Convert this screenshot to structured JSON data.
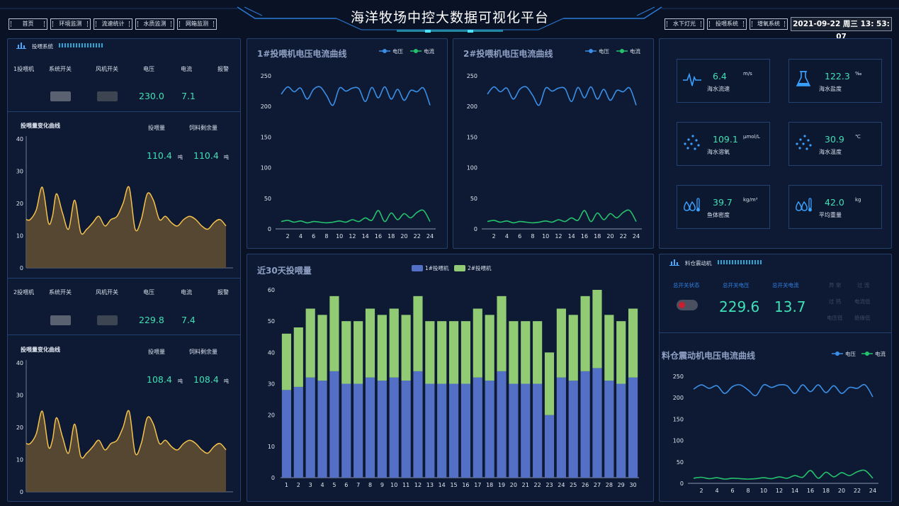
{
  "header": {
    "title": "海洋牧场中控大数据可视化平台",
    "nav_left": [
      "首页",
      "环境监测",
      "流速统计",
      "水质监测",
      "网箱监测"
    ],
    "nav_right": [
      "水下灯光",
      "投喂系统",
      "增氧系统"
    ],
    "datetime": "2021-09-22 周三 13: 53: 07"
  },
  "feeder_panel": {
    "title": "投喂系统",
    "columns": [
      "系统开关",
      "风机开关",
      "电压",
      "电流",
      "报警"
    ],
    "units": [
      {
        "name": "1投喂机",
        "voltage": "230.0",
        "current": "7.1",
        "curve_title": "投喂量变化曲线",
        "feed_label": "投喂量",
        "remain_label": "饲料剩余量",
        "feed": "110.4",
        "feed_unit": "吨",
        "remain": "110.4",
        "remain_unit": "吨"
      },
      {
        "name": "2投喂机",
        "voltage": "229.8",
        "current": "7.4",
        "curve_title": "投喂量变化曲线",
        "feed_label": "投喂量",
        "remain_label": "饲料剩余量",
        "feed": "108.4",
        "feed_unit": "吨",
        "remain": "108.4",
        "remain_unit": "吨"
      }
    ]
  },
  "vc_legend": {
    "voltage": "电压",
    "current": "电流"
  },
  "sensors": [
    {
      "value": "6.4",
      "unit": "m/s",
      "label": "海水流速",
      "icon": "pulse-icon"
    },
    {
      "value": "122.3",
      "unit": "‰",
      "label": "海水盐度",
      "icon": "flask-icon"
    },
    {
      "value": "109.1",
      "unit": "μmol/L",
      "label": "海水溶氧",
      "icon": "bubbles-icon"
    },
    {
      "value": "30.9",
      "unit": "℃",
      "label": "海水温度",
      "icon": "bubbles-icon"
    },
    {
      "value": "39.7",
      "unit": "kg/m³",
      "label": "鱼体密度",
      "icon": "drops-thermometer-icon"
    },
    {
      "value": "42.0",
      "unit": "kg",
      "label": "平均重量",
      "icon": "drops-thermometer-icon"
    }
  ],
  "hopper_panel": {
    "title": "料仓震动机",
    "headers": [
      "总开关状态",
      "总开关电压",
      "总开关电流"
    ],
    "voltage": "229.6",
    "current": "13.7",
    "alarms": [
      "异 常",
      "过 流",
      "过 热",
      "电流低",
      "电压低",
      "绝缘低"
    ],
    "curve_title": "料仓震动机电压电流曲线"
  },
  "colors": {
    "voltage": "#3a8ee6",
    "current": "#25c26e",
    "feed_line": "#f4c24c",
    "bar1": "#5470c6",
    "bar2": "#91cc75",
    "accent": "#3fe0b6"
  },
  "chart_data": [
    {
      "type": "line",
      "title": "1#投喂机电压电流曲线",
      "x": [
        1,
        2,
        3,
        4,
        5,
        6,
        7,
        8,
        9,
        10,
        11,
        12,
        13,
        14,
        15,
        16,
        17,
        18,
        19,
        20,
        21,
        22,
        23,
        24
      ],
      "ylim": [
        0,
        250
      ],
      "yticks": [
        0,
        50,
        100,
        150,
        200,
        250
      ],
      "xticks": [
        2,
        4,
        6,
        8,
        10,
        12,
        14,
        16,
        18,
        20,
        22,
        24
      ],
      "series": [
        {
          "name": "电压",
          "values": [
            220,
            232,
            224,
            230,
            212,
            228,
            232,
            218,
            202,
            230,
            225,
            230,
            229,
            208,
            231,
            214,
            232,
            212,
            228,
            210,
            226,
            224,
            230,
            202
          ]
        },
        {
          "name": "电流",
          "values": [
            12,
            14,
            11,
            13,
            10,
            12,
            11,
            10,
            11,
            13,
            11,
            15,
            12,
            18,
            14,
            30,
            12,
            26,
            15,
            25,
            18,
            27,
            30,
            12
          ]
        }
      ]
    },
    {
      "type": "line",
      "title": "2#投喂机电压电流曲线",
      "x": [
        1,
        2,
        3,
        4,
        5,
        6,
        7,
        8,
        9,
        10,
        11,
        12,
        13,
        14,
        15,
        16,
        17,
        18,
        19,
        20,
        21,
        22,
        23,
        24
      ],
      "ylim": [
        0,
        250
      ],
      "yticks": [
        0,
        50,
        100,
        150,
        200,
        250
      ],
      "xticks": [
        2,
        4,
        6,
        8,
        10,
        12,
        14,
        16,
        18,
        20,
        22,
        24
      ],
      "series": [
        {
          "name": "电压",
          "values": [
            220,
            232,
            224,
            230,
            212,
            228,
            232,
            218,
            202,
            230,
            225,
            230,
            229,
            208,
            231,
            214,
            232,
            212,
            228,
            210,
            226,
            224,
            230,
            202
          ]
        },
        {
          "name": "电流",
          "values": [
            12,
            14,
            11,
            13,
            10,
            12,
            11,
            10,
            11,
            13,
            11,
            15,
            12,
            18,
            14,
            30,
            12,
            26,
            15,
            25,
            18,
            27,
            30,
            12
          ]
        }
      ]
    },
    {
      "type": "bar",
      "title": "近30天投喂量",
      "stacked": true,
      "categories": [
        "1",
        "2",
        "3",
        "4",
        "5",
        "6",
        "7",
        "8",
        "9",
        "10",
        "11",
        "12",
        "13",
        "14",
        "15",
        "16",
        "17",
        "18",
        "19",
        "20",
        "21",
        "22",
        "23",
        "24",
        "25",
        "26",
        "27",
        "28",
        "29",
        "30"
      ],
      "ylim": [
        0,
        60
      ],
      "yticks": [
        0,
        10,
        20,
        30,
        40,
        50,
        60
      ],
      "series": [
        {
          "name": "1#投喂机",
          "values": [
            28,
            29,
            32,
            31,
            34,
            30,
            30,
            32,
            31,
            32,
            31,
            34,
            30,
            30,
            30,
            30,
            32,
            31,
            34,
            30,
            30,
            30,
            20,
            32,
            31,
            34,
            35,
            31,
            30,
            32
          ]
        },
        {
          "name": "2#投喂机",
          "values": [
            18,
            19,
            22,
            21,
            24,
            20,
            20,
            22,
            21,
            22,
            21,
            24,
            20,
            20,
            20,
            20,
            22,
            21,
            24,
            20,
            20,
            20,
            20,
            22,
            21,
            24,
            25,
            21,
            20,
            22
          ]
        }
      ]
    },
    {
      "type": "area",
      "title": "投喂量变化曲线",
      "ylim": [
        0,
        40
      ],
      "yticks": [
        0,
        10,
        20,
        30,
        40
      ],
      "x": [
        0,
        2,
        5,
        8,
        11,
        13,
        15,
        18,
        21,
        24,
        27,
        30,
        33,
        36,
        39,
        42,
        45,
        48,
        51,
        54,
        57,
        60,
        63,
        66,
        69,
        72,
        75,
        78,
        81,
        84,
        87,
        90,
        93,
        96,
        99
      ],
      "values": [
        15,
        15,
        18,
        25,
        14,
        16,
        23,
        17,
        12,
        21,
        11,
        12,
        14,
        16,
        13,
        15,
        16,
        20,
        25,
        12,
        15,
        23,
        21,
        15,
        16,
        14,
        13,
        15,
        16,
        15,
        13,
        12,
        14,
        15,
        13
      ]
    },
    {
      "type": "area",
      "title": "投喂量变化曲线",
      "ylim": [
        0,
        40
      ],
      "yticks": [
        0,
        10,
        20,
        30,
        40
      ],
      "x": [
        0,
        2,
        5,
        8,
        11,
        13,
        15,
        18,
        21,
        24,
        27,
        30,
        33,
        36,
        39,
        42,
        45,
        48,
        51,
        54,
        57,
        60,
        63,
        66,
        69,
        72,
        75,
        78,
        81,
        84,
        87,
        90,
        93,
        96,
        99
      ],
      "values": [
        15,
        15,
        18,
        25,
        14,
        16,
        23,
        17,
        12,
        21,
        11,
        12,
        14,
        16,
        13,
        15,
        16,
        20,
        25,
        12,
        15,
        23,
        21,
        15,
        16,
        14,
        13,
        15,
        16,
        15,
        13,
        12,
        14,
        15,
        13
      ]
    },
    {
      "type": "line",
      "title": "料仓震动机电压电流曲线",
      "x": [
        1,
        2,
        3,
        4,
        5,
        6,
        7,
        8,
        9,
        10,
        11,
        12,
        13,
        14,
        15,
        16,
        17,
        18,
        19,
        20,
        21,
        22,
        23,
        24
      ],
      "ylim": [
        0,
        250
      ],
      "yticks": [
        0,
        50,
        100,
        150,
        200,
        250
      ],
      "xticks": [
        2,
        4,
        6,
        8,
        10,
        12,
        14,
        16,
        18,
        20,
        22,
        24
      ],
      "series": [
        {
          "name": "电压",
          "values": [
            220,
            230,
            222,
            228,
            210,
            226,
            230,
            218,
            205,
            230,
            224,
            230,
            228,
            210,
            230,
            214,
            230,
            212,
            228,
            210,
            224,
            222,
            230,
            202
          ]
        },
        {
          "name": "电流",
          "values": [
            12,
            14,
            11,
            13,
            10,
            12,
            11,
            10,
            11,
            13,
            11,
            15,
            12,
            18,
            14,
            30,
            12,
            26,
            15,
            25,
            18,
            27,
            30,
            12
          ]
        }
      ]
    }
  ]
}
